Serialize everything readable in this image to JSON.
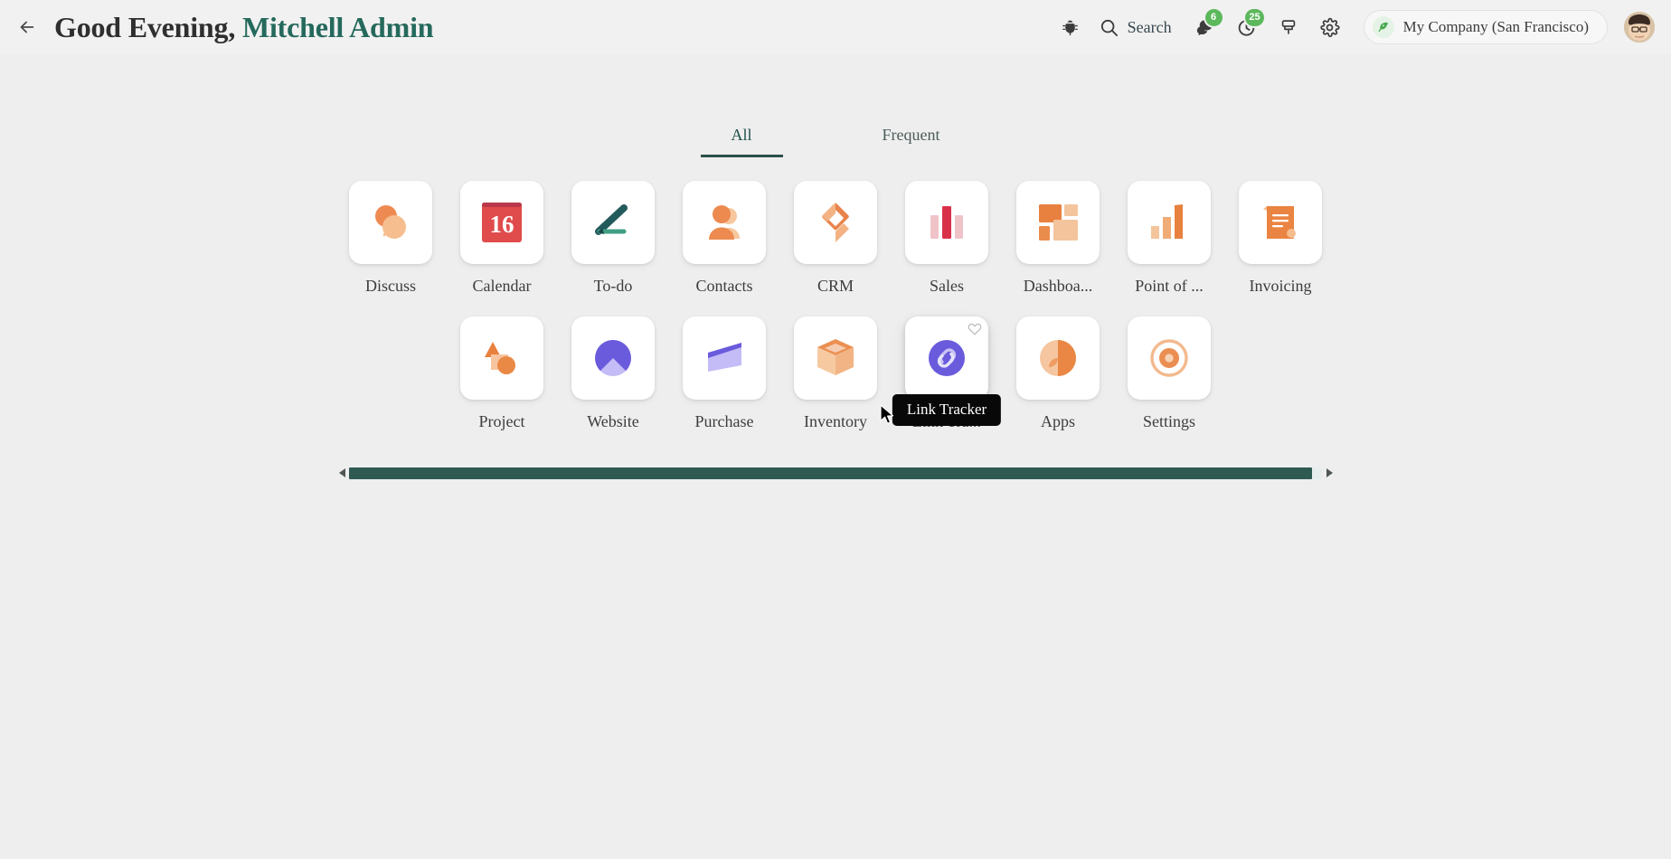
{
  "navbar": {
    "back_icon": "arrow-left-icon",
    "greeting_prefix": "Good Evening,",
    "user_name": "Mitchell Admin",
    "debug_icon": "bug-icon",
    "search_icon": "search-icon",
    "search_label": "Search",
    "messages_icon": "messages-icon",
    "messages_badge": "6",
    "activities_icon": "clock-icon",
    "activities_badge": "25",
    "mail_icon": "printer-icon",
    "settings_icon": "gear-icon",
    "company_icon": "leaf-icon",
    "company_name": "My Company (San Francisco)",
    "avatar_name": "user-avatar"
  },
  "tabs": [
    {
      "label": "All",
      "active": true
    },
    {
      "label": "Frequent",
      "active": false
    }
  ],
  "apps": {
    "row1": [
      {
        "label": "Discuss",
        "icon": "discuss-icon"
      },
      {
        "label": "Calendar",
        "icon": "calendar-icon",
        "day": "16"
      },
      {
        "label": "To-do",
        "icon": "todo-icon"
      },
      {
        "label": "Contacts",
        "icon": "contacts-icon"
      },
      {
        "label": "CRM",
        "icon": "crm-icon"
      },
      {
        "label": "Sales",
        "icon": "sales-icon"
      },
      {
        "label": "Dashboa...",
        "icon": "dashboards-icon"
      },
      {
        "label": "Point of ...",
        "icon": "point-of-sale-icon"
      },
      {
        "label": "Invoicing",
        "icon": "invoicing-icon"
      }
    ],
    "row2": [
      {
        "label": "Project",
        "icon": "project-icon"
      },
      {
        "label": "Website",
        "icon": "website-icon"
      },
      {
        "label": "Purchase",
        "icon": "purchase-icon"
      },
      {
        "label": "Inventory",
        "icon": "inventory-icon"
      },
      {
        "label": "Link Tra...",
        "icon": "link-tracker-icon",
        "hovered": true,
        "tooltip": "Link Tracker",
        "favorite_icon": "heart-icon"
      },
      {
        "label": "Apps",
        "icon": "apps-icon"
      },
      {
        "label": "Settings",
        "icon": "settings-icon"
      }
    ]
  },
  "scrollbar": {
    "left_arrow_icon": "caret-left-icon",
    "right_arrow_icon": "caret-right-icon",
    "thumb_name": "horizontal-scroll-thumb"
  },
  "colors": {
    "accent_teal": "#24695c",
    "scrollbar_thumb": "#2f5a52",
    "badge_green": "#5cb85c",
    "background": "#eeeeee",
    "tile_white": "#ffffff",
    "odoo_orange": "#e8764e",
    "odoo_purple": "#6457d9",
    "calendar_red": "#e04b4b"
  }
}
